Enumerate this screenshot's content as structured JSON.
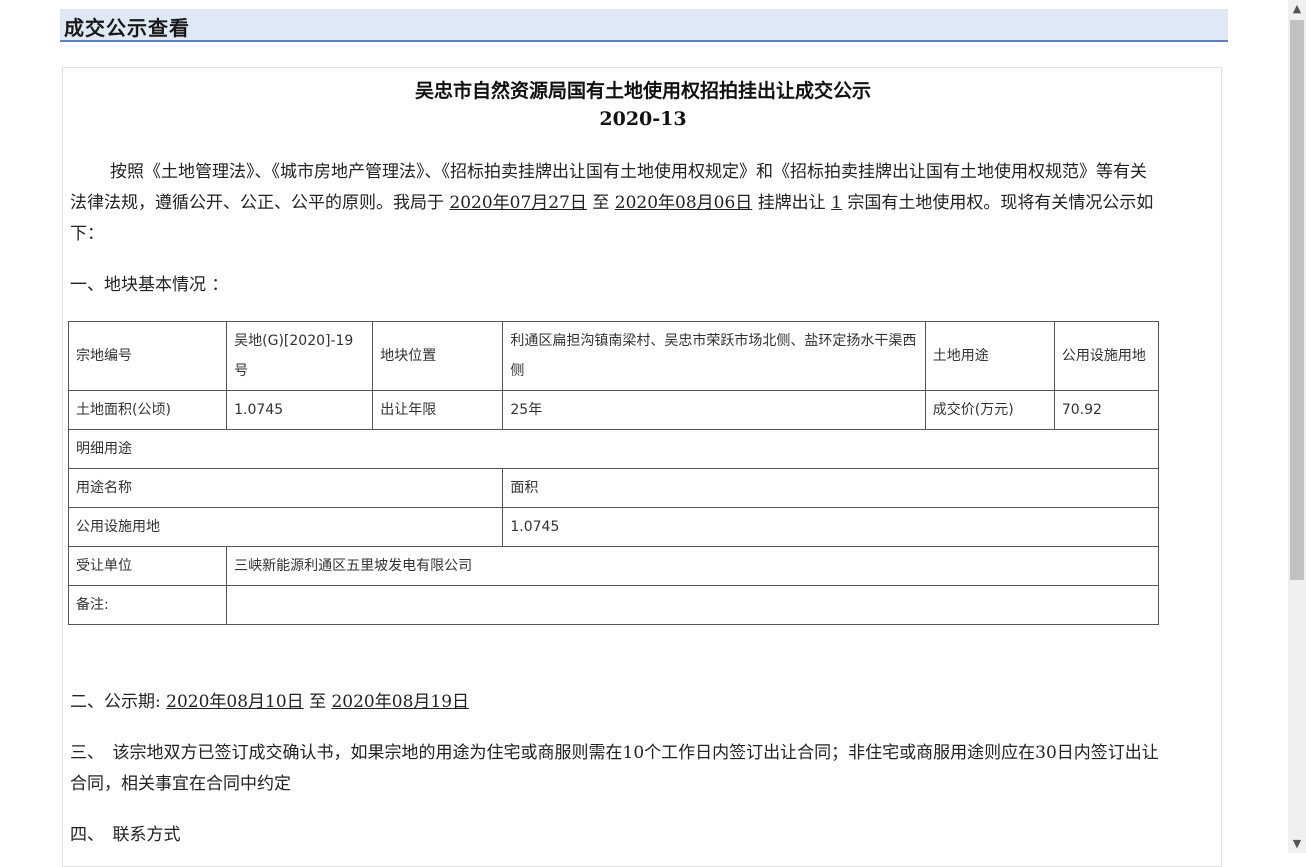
{
  "header": {
    "title": "成交公示查看"
  },
  "doc": {
    "title": "吴忠市自然资源局国有土地使用权招拍挂出让成交公示",
    "number": "2020-13",
    "intro": {
      "text1": "按照《土地管理法》、《城市房地产管理法》、《招标拍卖挂牌出让国有土地使用权规定》和《招标拍卖挂牌出让国有土地使用权规范》等有关法律法规，遵循公开、公正、公平的原则。我局于",
      "date_start": "2020年07月27日",
      "to1": "至",
      "date_end": "2020年08月06日",
      "text2": "挂牌出让",
      "count": "1",
      "text3": "宗国有土地使用权。现将有关情况公示如下："
    },
    "section1": "一、地块基本情况 ：",
    "table": {
      "row1": {
        "label_code": "宗地编号",
        "code": "吴地(G)[2020]-19号",
        "label_location": "地块位置",
        "location": "利通区扁担沟镇南梁村、吴忠市荣跃市场北侧、盐环定扬水干渠西侧",
        "label_use": "土地用途",
        "use": "公用设施用地"
      },
      "row2": {
        "label_area": "土地面积(公顷)",
        "area": "1.0745",
        "label_term": "出让年限",
        "term": "25年",
        "label_price": "成交价(万元)",
        "price": "70.92"
      },
      "detail_header": "明细用途",
      "detail_col_name": "用途名称",
      "detail_col_area": "面积",
      "detail_name": "公用设施用地",
      "detail_area": "1.0745",
      "label_assignee": "受让单位",
      "assignee": "三峡新能源利通区五里坡发电有限公司",
      "label_remark": "备注:",
      "remark": ""
    },
    "section2": {
      "label": "二、公示期:",
      "date_start": "2020年08月10日",
      "to": "至",
      "date_end": "2020年08月19日"
    },
    "section3": "三、　该宗地双方已签订成交确认书，如果宗地的用途为住宅或商服则需在10个工作日内签订出让合同；非住宅或商服用途则应在30日内签订出让合同，相关事宜在合同中约定",
    "section4": "四、　联系方式"
  },
  "scrollbar": {
    "up_arrow": "up-arrow",
    "down_arrow": "down-arrow"
  }
}
